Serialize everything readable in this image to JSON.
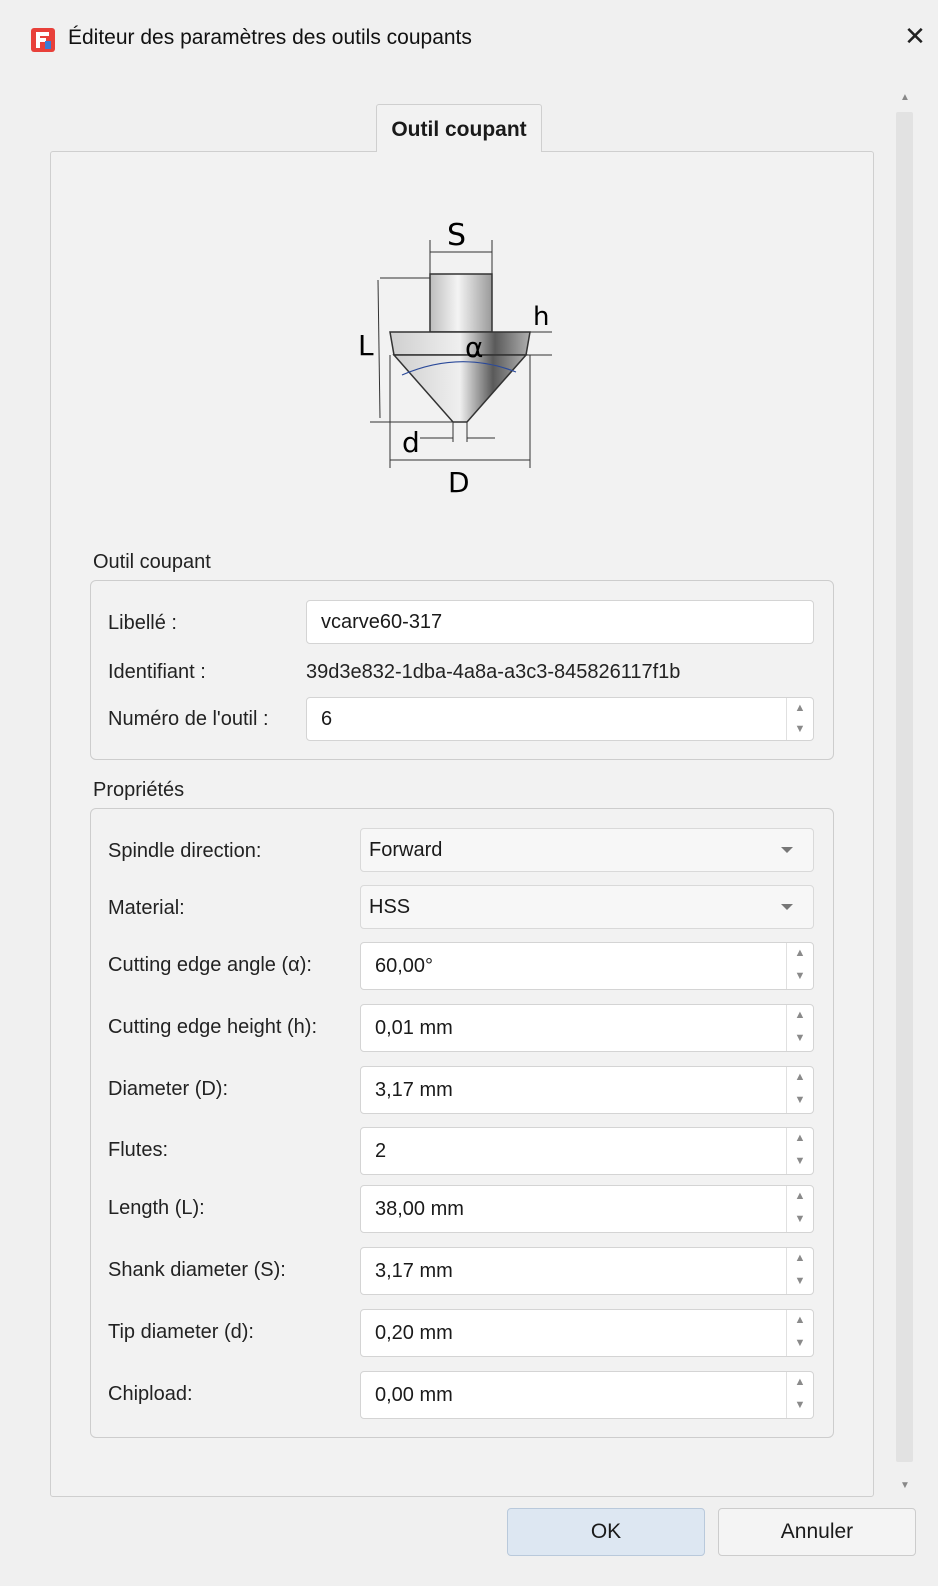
{
  "window": {
    "title": "Éditeur des paramètres des outils coupants",
    "close_symbol": "✕"
  },
  "tab": {
    "label": "Outil coupant"
  },
  "diagram": {
    "labels": {
      "S": "S",
      "L": "L",
      "h": "h",
      "alpha": "α",
      "d": "d",
      "D": "D"
    }
  },
  "tool_group": {
    "title": "Outil coupant",
    "label_name": "Libellé :",
    "name_value": "vcarve60-317",
    "label_id": "Identifiant :",
    "id_value": "39d3e832-1dba-4a8a-a3c3-845826117f1b",
    "label_number": "Numéro de l'outil :",
    "number_value": "6"
  },
  "props_group": {
    "title": "Propriétés",
    "rows": [
      {
        "label": "Spindle direction:",
        "value": "Forward",
        "kind": "combo"
      },
      {
        "label": "Material:",
        "value": "HSS",
        "kind": "combo"
      },
      {
        "label": "Cutting edge angle (α):",
        "value": "60,00°",
        "kind": "spin"
      },
      {
        "label": "Cutting edge height (h):",
        "value": "0,01 mm",
        "kind": "spin"
      },
      {
        "label": "Diameter (D):",
        "value": "3,17 mm",
        "kind": "spin"
      },
      {
        "label": "Flutes:",
        "value": "2",
        "kind": "spin"
      },
      {
        "label": "Length (L):",
        "value": "38,00 mm",
        "kind": "spin"
      },
      {
        "label": "Shank diameter (S):",
        "value": "3,17 mm",
        "kind": "spin"
      },
      {
        "label": "Tip diameter (d):",
        "value": "0,20 mm",
        "kind": "spin"
      },
      {
        "label": "Chipload:",
        "value": "0,00 mm",
        "kind": "spin"
      }
    ]
  },
  "buttons": {
    "ok": "OK",
    "cancel": "Annuler"
  },
  "colors": {
    "accent_icon": "#e8403a",
    "ok_button": "#dde7f2"
  }
}
